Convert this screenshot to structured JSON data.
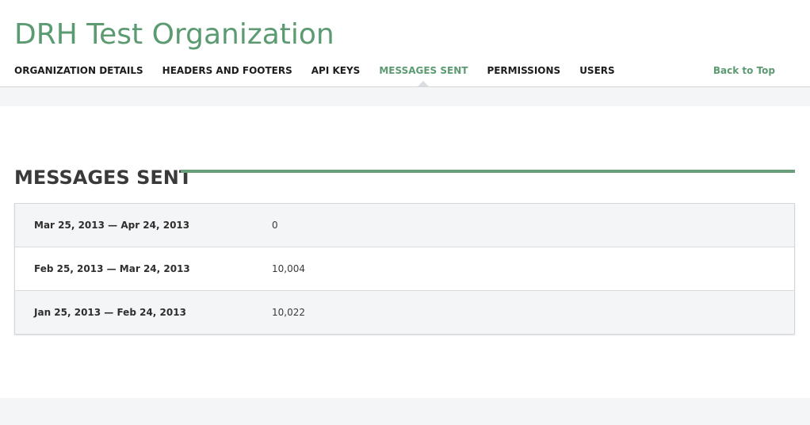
{
  "org": {
    "title": "DRH Test Organization"
  },
  "nav": {
    "items": [
      {
        "label": "ORGANIZATION DETAILS",
        "active": false
      },
      {
        "label": "HEADERS AND FOOTERS",
        "active": false
      },
      {
        "label": "API KEYS",
        "active": false
      },
      {
        "label": "MESSAGES SENT",
        "active": true
      },
      {
        "label": "PERMISSIONS",
        "active": false
      },
      {
        "label": "USERS",
        "active": false
      }
    ],
    "back_to_top": "Back to Top"
  },
  "messages_sent": {
    "title": "MESSAGES SENT",
    "rows": [
      {
        "range": "Mar 25, 2013 — Apr 24, 2013",
        "count": "0"
      },
      {
        "range": "Feb 25, 2013 — Mar 24, 2013",
        "count": "10,004"
      },
      {
        "range": "Jan 25, 2013 — Feb 24, 2013",
        "count": "10,022"
      }
    ]
  },
  "colors": {
    "accent": "#5c9a72",
    "rule": "#6b9e7a",
    "shaded_row": "#f4f5f7"
  }
}
